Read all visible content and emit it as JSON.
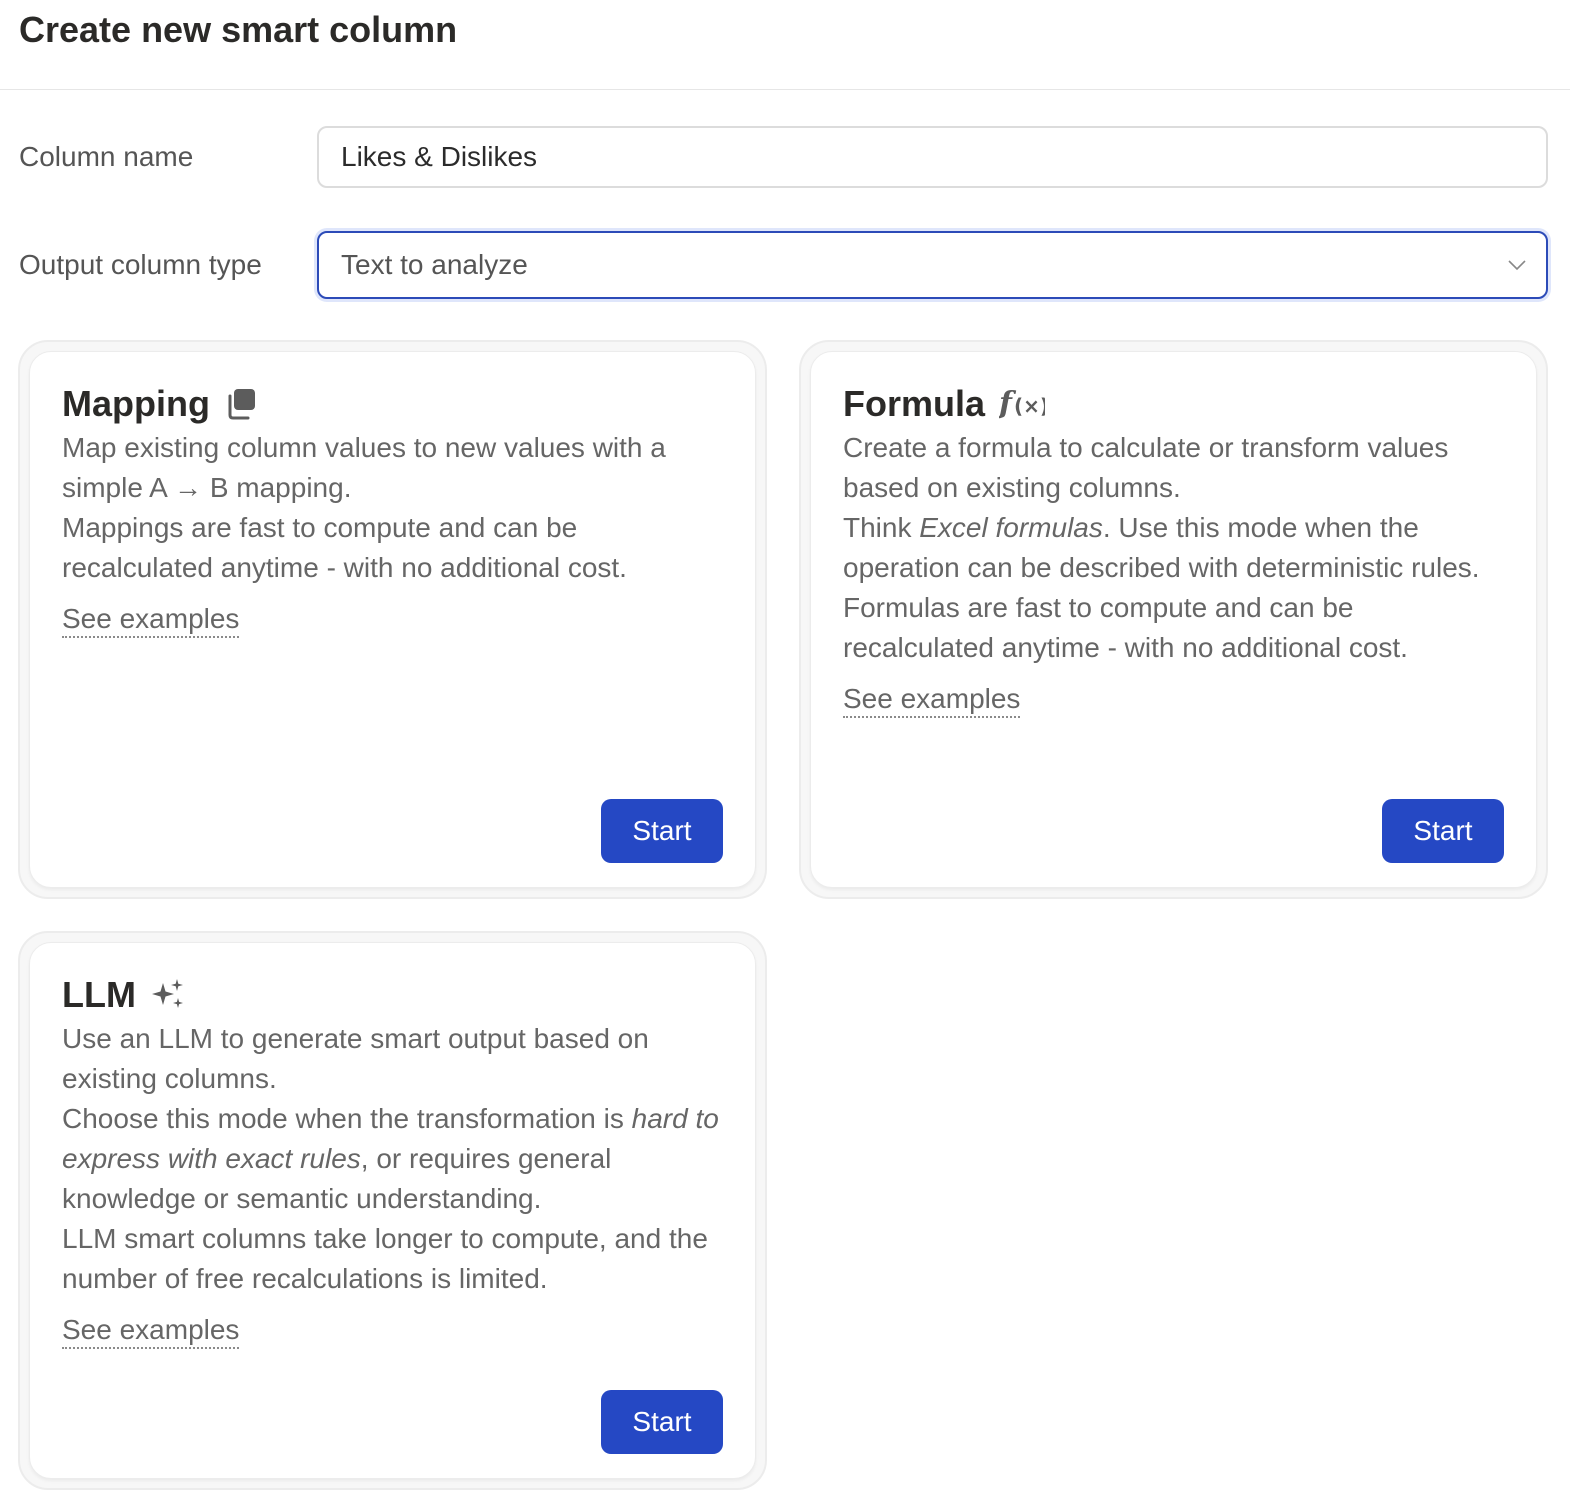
{
  "dialog": {
    "title": "Create new smart column"
  },
  "form": {
    "column_name_label": "Column name",
    "column_name_value": "Likes & Dislikes",
    "output_type_label": "Output column type",
    "output_type_value": "Text to analyze"
  },
  "cards": {
    "mapping": {
      "title": "Mapping",
      "icon": "copy-icon",
      "lines": [
        "Map existing column values to new values with a simple A → B mapping.",
        "Mappings are fast to compute and can be recalculated anytime - with no additional cost."
      ],
      "link": "See examples",
      "button": "Start"
    },
    "formula": {
      "title": "Formula",
      "icon": "function-icon",
      "line1": "Create a formula to calculate or transform values based on existing columns.",
      "line2_pre": "Think ",
      "line2_em": "Excel formulas",
      "line2_post": ". Use this mode when the operation can be described with deterministic rules.",
      "line3": "Formulas are fast to compute and can be recalculated anytime - with no additional cost.",
      "link": "See examples",
      "button": "Start"
    },
    "llm": {
      "title": "LLM",
      "icon": "sparkles-icon",
      "line1": "Use an LLM to generate smart output based on existing columns.",
      "line2_pre": "Choose this mode when the transformation is ",
      "line2_em": "hard to express with exact rules",
      "line2_post": ", or requires general knowledge or semantic understanding.",
      "line3": "LLM smart columns take longer to compute, and the number of free recalculations is limited.",
      "link": "See examples",
      "button": "Start"
    }
  },
  "colors": {
    "primary_button": "#2548c4",
    "focus_border": "#2c4bb8"
  }
}
